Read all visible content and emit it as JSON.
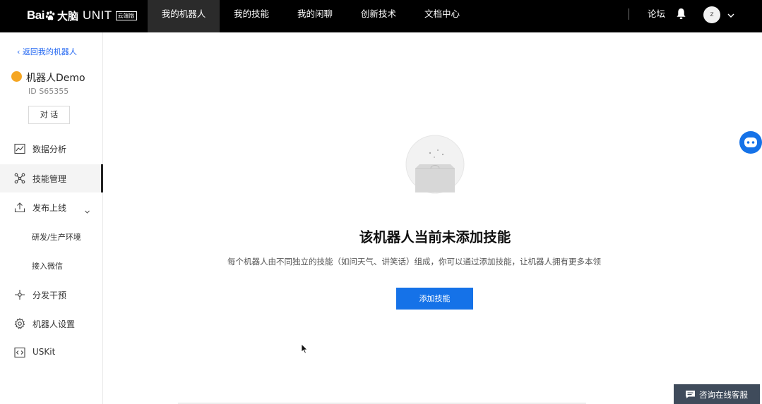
{
  "header": {
    "logo_text": "Bai",
    "logo_text2": "大脑",
    "logo_product": "UNIT",
    "logo_tag": "云端版",
    "nav": [
      {
        "label": "我的机器人",
        "active": true
      },
      {
        "label": "我的技能",
        "active": false
      },
      {
        "label": "我的闲聊",
        "active": false
      },
      {
        "label": "创新技术",
        "active": false
      },
      {
        "label": "文档中心",
        "active": false
      }
    ],
    "forum": "论坛",
    "avatar_initial": "z"
  },
  "sidebar": {
    "back": "返回我的机器人",
    "robot_name": "机器人Demo",
    "robot_id": "ID S65355",
    "chat_button": "对 话",
    "menu": [
      {
        "label": "数据分析",
        "icon": "chart-icon"
      },
      {
        "label": "技能管理",
        "icon": "skill-network-icon",
        "active": true
      },
      {
        "label": "发布上线",
        "icon": "upload-icon",
        "expanded": true
      },
      {
        "label": "分发干预",
        "icon": "distribute-icon"
      },
      {
        "label": "机器人设置",
        "icon": "gear-icon"
      },
      {
        "label": "USKit",
        "icon": "code-icon"
      }
    ],
    "submenu": [
      {
        "label": "研发/生产环境"
      },
      {
        "label": "接入微信"
      }
    ]
  },
  "main": {
    "empty_title": "该机器人当前未添加技能",
    "empty_desc": "每个机器人由不同独立的技能（如问天气、讲笑话）组成，你可以通过添加技能，让机器人拥有更多本领",
    "add_button": "添加技能"
  },
  "service": {
    "label": "咨询在线客服"
  },
  "colors": {
    "accent": "#1572e8",
    "link": "#2468f2",
    "topbar": "#000000",
    "badge": "#f5a623",
    "service": "#3f4b5b"
  }
}
